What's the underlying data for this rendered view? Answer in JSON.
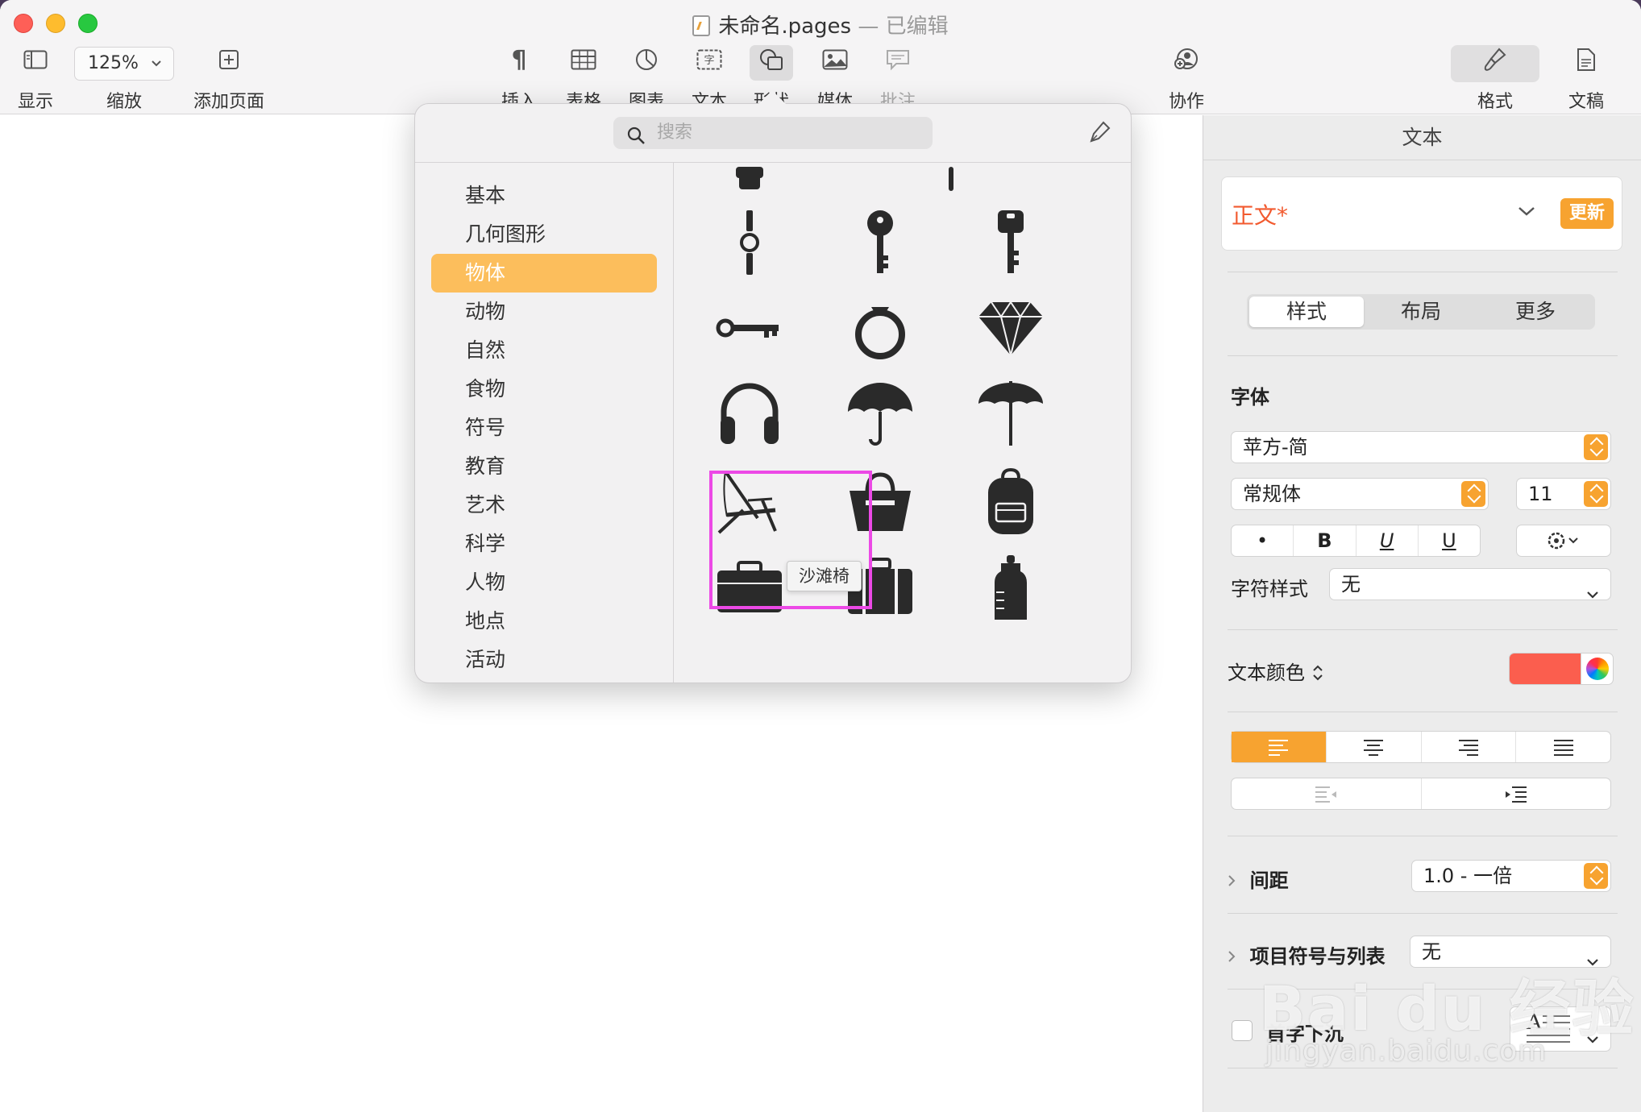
{
  "window": {
    "title": "未命名.pages",
    "separator": "—",
    "status": "已编辑"
  },
  "toolbar": {
    "view_label": "显示",
    "zoom_value": "125%",
    "zoom_label": "缩放",
    "add_page_label": "添加页面",
    "insert_label": "插入",
    "table_label": "表格",
    "chart_label": "图表",
    "text_label": "文本",
    "shape_label": "形状",
    "media_label": "媒体",
    "comment_label": "批注",
    "collaborate_label": "协作",
    "format_label": "格式",
    "document_label": "文稿"
  },
  "shape_popover": {
    "search_placeholder": "搜索",
    "categories": [
      "基本",
      "几何图形",
      "物体",
      "动物",
      "自然",
      "食物",
      "符号",
      "教育",
      "艺术",
      "科学",
      "人物",
      "地点",
      "活动"
    ],
    "active_category": "物体",
    "tooltip": "沙滩椅",
    "shapes": [
      "watch-icon",
      "key-icon",
      "car-key-icon",
      "old-key-icon",
      "ring-icon",
      "diamond-icon",
      "headphones-icon",
      "umbrella-icon",
      "beach-umbrella-icon",
      "beach-chair-icon",
      "handbag-icon",
      "backpack-icon",
      "briefcase-icon",
      "suitcase-icon",
      "bottle-icon"
    ]
  },
  "format_panel": {
    "header": "文本",
    "paragraph_style": "正文*",
    "update_button": "更新",
    "tabs": [
      "样式",
      "布局",
      "更多"
    ],
    "active_tab": "样式",
    "font_section": "字体",
    "font_family": "苹方-简",
    "font_weight": "常规体",
    "font_size": "11",
    "style_buttons": [
      "•",
      "B",
      "U",
      "U"
    ],
    "char_style_label": "字符样式",
    "char_style_value": "无",
    "text_color_label": "文本颜色",
    "text_color": "#fb5e4e",
    "alignment_active": "left",
    "spacing_label": "间距",
    "spacing_value": "1.0 - 一倍",
    "bullets_label": "项目符号与列表",
    "bullets_value": "无",
    "drop_cap_label": "首字下沉"
  },
  "watermark": {
    "text": "Bai du 经验",
    "url": "jingyan.baidu.com"
  },
  "colors": {
    "accent": "#f7a330",
    "active_category": "#fcbe5c",
    "highlight_box": "#ec49e6"
  }
}
